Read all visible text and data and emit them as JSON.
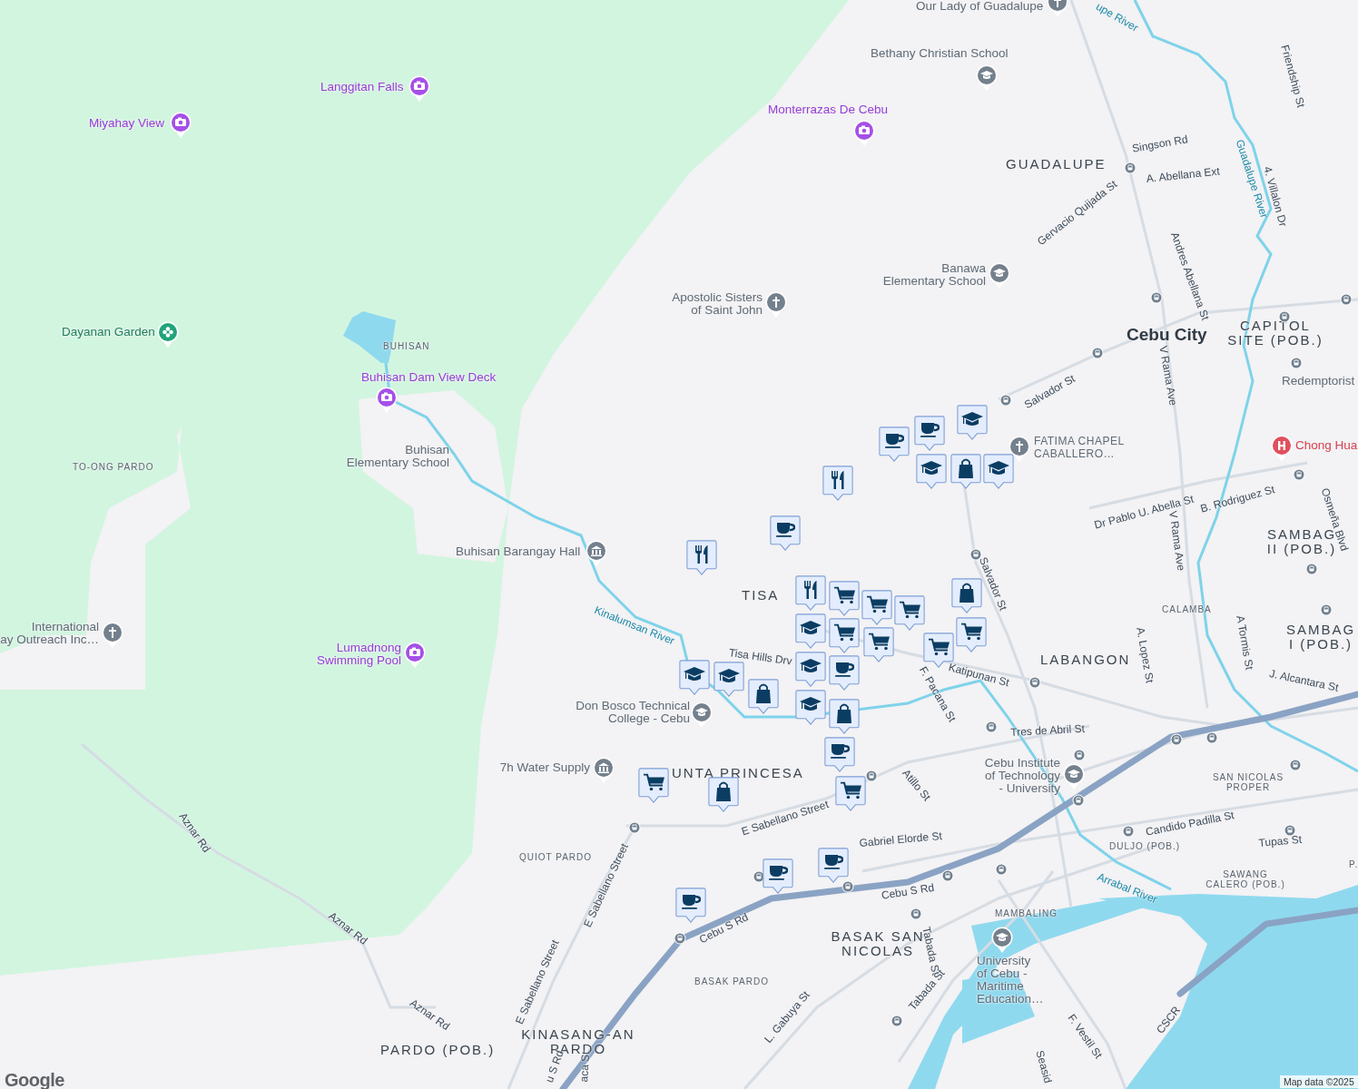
{
  "map": {
    "area_labels": [
      {
        "text": "GUADALUPE",
        "kind": "district"
      },
      {
        "text": "BUHISAN",
        "kind": "neighborhood"
      },
      {
        "text": "Cebu City",
        "kind": "city"
      },
      {
        "text": "CAPITOL\nSITE (POB.)",
        "kind": "district"
      },
      {
        "text": "TO-ONG PARDO",
        "kind": "neighborhood"
      },
      {
        "text": "SAMBAG\nII (POB.)",
        "kind": "district"
      },
      {
        "text": "TISA",
        "kind": "district"
      },
      {
        "text": "CALAMBA",
        "kind": "neighborhood"
      },
      {
        "text": "SAMBAG\nI (POB.)",
        "kind": "district"
      },
      {
        "text": "LABANGON",
        "kind": "district"
      },
      {
        "text": "UNTA PRINCESA",
        "kind": "district"
      },
      {
        "text": "SAN NICOLAS\nPROPER",
        "kind": "neighborhood"
      },
      {
        "text": "DULJO (POB.)",
        "kind": "neighborhood"
      },
      {
        "text": "QUIOT PARDO",
        "kind": "neighborhood"
      },
      {
        "text": "SAWANG\nCALERO (POB.)",
        "kind": "neighborhood"
      },
      {
        "text": "P.",
        "kind": "neighborhood"
      },
      {
        "text": "MAMBALING",
        "kind": "neighborhood"
      },
      {
        "text": "BASAK SAN\nNICOLAS",
        "kind": "district"
      },
      {
        "text": "BASAK PARDO",
        "kind": "neighborhood"
      },
      {
        "text": "PARDO (POB.)",
        "kind": "district"
      },
      {
        "text": "KINASANG-AN\nPARDO",
        "kind": "district"
      }
    ],
    "places": [
      {
        "name": "Our Lady of Guadalupe",
        "kind": "worship"
      },
      {
        "name": "Bethany Christian School",
        "kind": "school"
      },
      {
        "name": "Monterrazas De Cebu",
        "kind": "attraction"
      },
      {
        "name": "Langgitan Falls",
        "kind": "attraction"
      },
      {
        "name": "Miyahay View",
        "kind": "attraction"
      },
      {
        "name": "Banawa\nElementary School",
        "kind": "school"
      },
      {
        "name": "Apostolic Sisters\nof Saint John",
        "kind": "worship"
      },
      {
        "name": "Dayanan Garden",
        "kind": "garden"
      },
      {
        "name": "Buhisan Dam View Deck",
        "kind": "attraction"
      },
      {
        "name": "Redemptorist",
        "kind": "label"
      },
      {
        "name": "FATIMA CHAPEL\nCABALLERO…",
        "kind": "worship"
      },
      {
        "name": "Chong Hua",
        "kind": "hospital"
      },
      {
        "name": "Buhisan\nElementary School",
        "kind": "label"
      },
      {
        "name": "Buhisan Barangay Hall",
        "kind": "civic"
      },
      {
        "name": "International\nay Outreach Inc…",
        "kind": "worship"
      },
      {
        "name": "Lumadnong\nSwimming Pool",
        "kind": "attraction"
      },
      {
        "name": "Don Bosco Technical\nCollege - Cebu",
        "kind": "school"
      },
      {
        "name": "7h Water Supply",
        "kind": "civic"
      },
      {
        "name": "Cebu Institute\nof Technology\n- University",
        "kind": "school"
      },
      {
        "name": "University\nof Cebu -\nMaritime\nEducation…",
        "kind": "school"
      }
    ],
    "streets": [
      {
        "name": "upe River",
        "kind": "river"
      },
      {
        "name": "Friendship St",
        "kind": "road"
      },
      {
        "name": "Singson Rd",
        "kind": "road"
      },
      {
        "name": "A. Abellana Ext",
        "kind": "road"
      },
      {
        "name": "Guadalupe River",
        "kind": "river"
      },
      {
        "name": "4. Villalon Dr",
        "kind": "road"
      },
      {
        "name": "Gervacio Quijada St",
        "kind": "road"
      },
      {
        "name": "Andres Abellana St",
        "kind": "road"
      },
      {
        "name": "Salvador St",
        "kind": "road"
      },
      {
        "name": "V Rama Ave",
        "kind": "road"
      },
      {
        "name": "Dr Pablo U. Abella St",
        "kind": "road"
      },
      {
        "name": "B. Rodriguez St",
        "kind": "road"
      },
      {
        "name": "Osmeña Blvd",
        "kind": "road"
      },
      {
        "name": "V Rama Ave",
        "kind": "road"
      },
      {
        "name": "Salvador St",
        "kind": "road"
      },
      {
        "name": "Kinalumsan River",
        "kind": "river"
      },
      {
        "name": "Tisa Hills Drv",
        "kind": "road"
      },
      {
        "name": "A. Lopez St",
        "kind": "road"
      },
      {
        "name": "A Tormis St",
        "kind": "road"
      },
      {
        "name": "Katipunan St",
        "kind": "road"
      },
      {
        "name": "J. Alcantara St",
        "kind": "road"
      },
      {
        "name": "F. Pacana St",
        "kind": "road"
      },
      {
        "name": "Tres de Abril St",
        "kind": "road"
      },
      {
        "name": "Atillo St",
        "kind": "road"
      },
      {
        "name": "E Sabellano Street",
        "kind": "road"
      },
      {
        "name": "Candido Padilla St",
        "kind": "road"
      },
      {
        "name": "Aznar Rd",
        "kind": "road"
      },
      {
        "name": "Gabriel Elorde St",
        "kind": "road"
      },
      {
        "name": "Tupas St",
        "kind": "road"
      },
      {
        "name": "E Sabellano Street",
        "kind": "road"
      },
      {
        "name": "Arrabal River",
        "kind": "river"
      },
      {
        "name": "Cebu S Rd",
        "kind": "road"
      },
      {
        "name": "Aznar Rd",
        "kind": "road"
      },
      {
        "name": "Cebu S Rd",
        "kind": "road"
      },
      {
        "name": "Tabada St",
        "kind": "road"
      },
      {
        "name": "E Sabellano Street",
        "kind": "road"
      },
      {
        "name": "Aznar Rd",
        "kind": "road"
      },
      {
        "name": "CSCR",
        "kind": "road"
      },
      {
        "name": "Tabada St",
        "kind": "road"
      },
      {
        "name": "L. Gabuya St",
        "kind": "road"
      },
      {
        "name": "F. Vestil St",
        "kind": "road"
      },
      {
        "name": "u S Rd",
        "kind": "road"
      },
      {
        "name": "aca St",
        "kind": "road"
      },
      {
        "name": "Seasid",
        "kind": "road"
      }
    ],
    "markers": [
      {
        "kind": "cafe"
      },
      {
        "kind": "school"
      },
      {
        "kind": "cafe"
      },
      {
        "kind": "school"
      },
      {
        "kind": "shopping"
      },
      {
        "kind": "school"
      },
      {
        "kind": "restaurant"
      },
      {
        "kind": "cafe"
      },
      {
        "kind": "restaurant"
      },
      {
        "kind": "restaurant"
      },
      {
        "kind": "grocery"
      },
      {
        "kind": "grocery"
      },
      {
        "kind": "grocery"
      },
      {
        "kind": "shopping"
      },
      {
        "kind": "grocery"
      },
      {
        "kind": "grocery"
      },
      {
        "kind": "grocery"
      },
      {
        "kind": "grocery"
      },
      {
        "kind": "school"
      },
      {
        "kind": "cafe"
      },
      {
        "kind": "school"
      },
      {
        "kind": "school"
      },
      {
        "kind": "school"
      },
      {
        "kind": "shopping"
      },
      {
        "kind": "school"
      },
      {
        "kind": "shopping"
      },
      {
        "kind": "cafe"
      },
      {
        "kind": "grocery"
      },
      {
        "kind": "shopping"
      },
      {
        "kind": "grocery"
      },
      {
        "kind": "cafe"
      },
      {
        "kind": "cafe"
      },
      {
        "kind": "cafe"
      }
    ],
    "attribution": "Map data ©2025",
    "logo": "Google"
  }
}
